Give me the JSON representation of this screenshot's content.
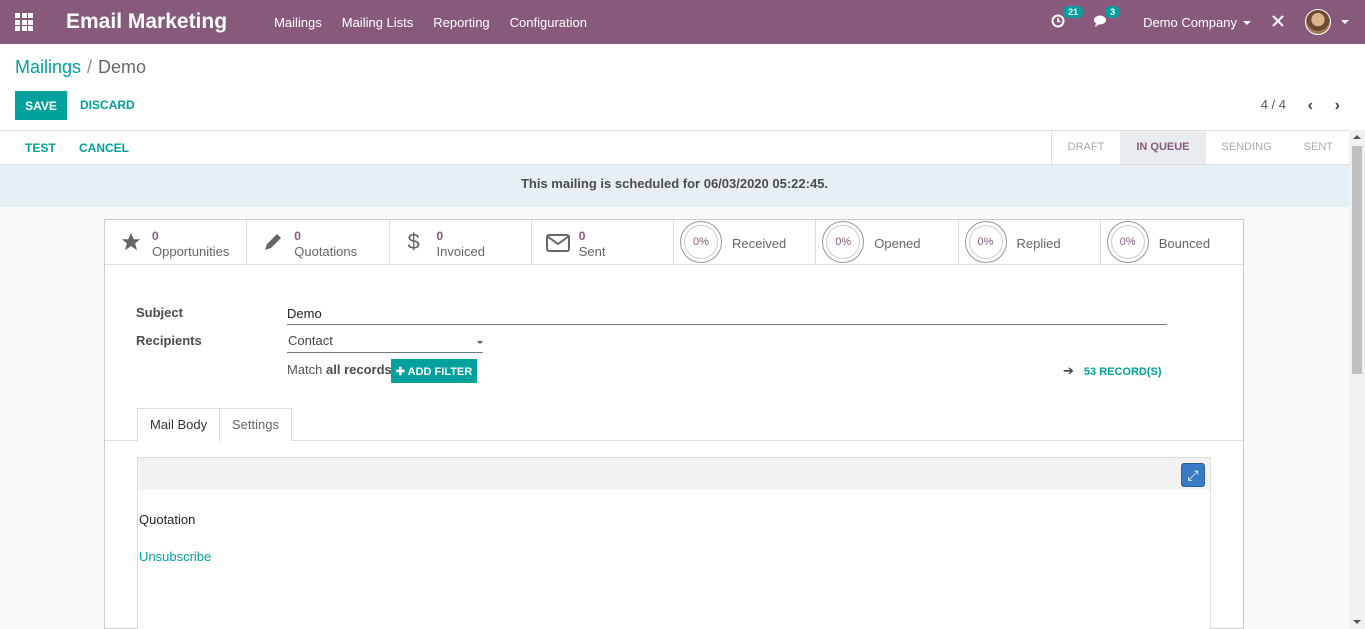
{
  "navbar": {
    "app_title": "Email Marketing",
    "menu": [
      "Mailings",
      "Mailing Lists",
      "Reporting",
      "Configuration"
    ],
    "activity_badge": "21",
    "messages_badge": "3",
    "company": "Demo Company"
  },
  "breadcrumb": {
    "parent": "Mailings",
    "current": "Demo"
  },
  "buttons": {
    "save": "SAVE",
    "discard": "DISCARD",
    "test": "TEST",
    "cancel": "CANCEL",
    "add_filter": "ADD FILTER"
  },
  "pager": {
    "value": "4 / 4"
  },
  "stages": [
    "DRAFT",
    "IN QUEUE",
    "SENDING",
    "SENT"
  ],
  "active_stage": "IN QUEUE",
  "alert": "This mailing is scheduled for 06/03/2020 05:22:45.",
  "stats": [
    {
      "count": "0",
      "label": "Opportunities",
      "icon": "star-icon"
    },
    {
      "count": "0",
      "label": "Quotations",
      "icon": "pencil-icon"
    },
    {
      "count": "0",
      "label": "Invoiced",
      "icon": "dollar-icon"
    },
    {
      "count": "0",
      "label": "Sent",
      "icon": "envelope-icon"
    }
  ],
  "rates": [
    {
      "value": "0%",
      "label": "Received"
    },
    {
      "value": "0%",
      "label": "Opened"
    },
    {
      "value": "0%",
      "label": "Replied"
    },
    {
      "value": "0%",
      "label": "Bounced"
    }
  ],
  "form": {
    "subject_label": "Subject",
    "subject_value": "Demo",
    "recipients_label": "Recipients",
    "recipients_value": "Contact",
    "match_prefix": "Match",
    "match_bold": "all records",
    "records_link": "53 RECORD(S)"
  },
  "tabs": [
    "Mail Body",
    "Settings"
  ],
  "body": {
    "text": "Quotation",
    "link": "Unsubscribe"
  },
  "colors": {
    "brand": "#875a7b",
    "accent": "#00a09d",
    "alert_bg": "#e6eff3"
  }
}
